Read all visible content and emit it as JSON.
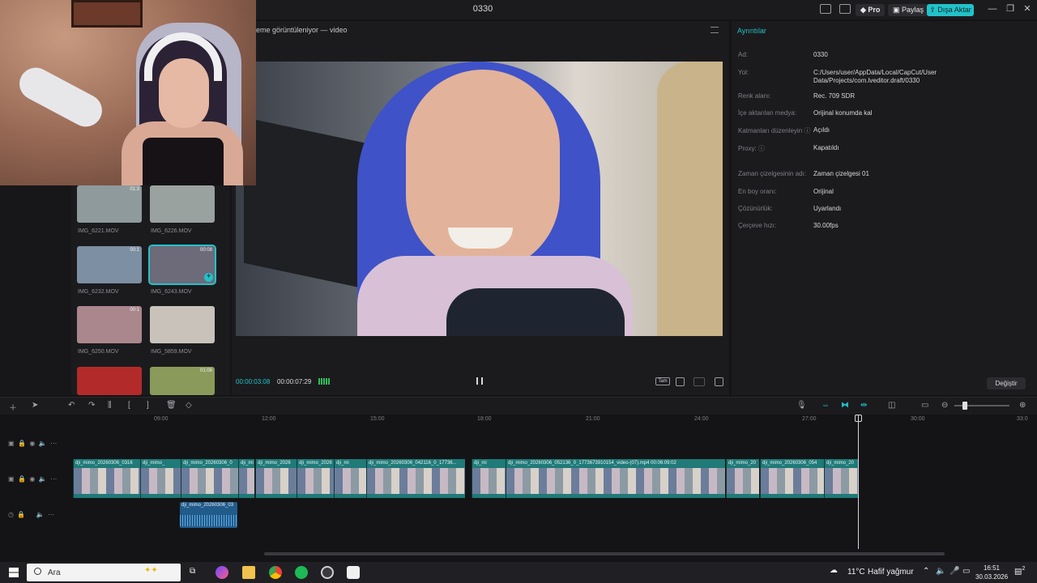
{
  "window": {
    "title": "0330"
  },
  "topbar": {
    "pro_label": "Pro",
    "share_label": "Paylaş",
    "export_label": "Dışa Aktar"
  },
  "player": {
    "title": "eme görüntüleniyor — video",
    "current_time": "00:00:03:08",
    "total_time": "00:00:07:29",
    "fit_label": "Tam"
  },
  "details": {
    "tab_label": "Ayrıntılar",
    "rows": [
      {
        "label": "Ad:",
        "value": "0330"
      },
      {
        "label": "Yol:",
        "value": "C:/Users/user/AppData/Local/CapCut/User Data/Projects/com.lveditor.draft/0330"
      },
      {
        "label": "Renk alanı:",
        "value": "Rec. 709 SDR"
      },
      {
        "label": "İçe aktarılan medya:",
        "value": "Orijinal konumda kal"
      },
      {
        "label": "Katmanları düzenleyin ⓘ",
        "value": "Açıldı"
      },
      {
        "label": "Proxy: ⓘ",
        "value": "Kapatıldı"
      },
      {
        "label": "Zaman çizelgesinin adı:",
        "value": "Zaman çizelgesi 01"
      },
      {
        "label": "En boy oranı:",
        "value": "Orijinal"
      },
      {
        "label": "Çözünürlük:",
        "value": "Uyarlandı"
      },
      {
        "label": "Çerçeve hızı:",
        "value": "30.00fps"
      }
    ],
    "change_label": "Değiştir"
  },
  "media": {
    "items": [
      {
        "name": "IMG_6221.MOV",
        "duration": "01:3",
        "color": "#8e9a9c"
      },
      {
        "name": "IMG_6226.MOV",
        "duration": "",
        "color": "#9aa2a0"
      },
      {
        "name": "IMG_6232.MOV",
        "duration": "00:1",
        "color": "#7d8fa3"
      },
      {
        "name": "IMG_6243.MOV",
        "duration": "00:08",
        "color": "#6d6a7a"
      },
      {
        "name": "IMG_6250.MOV",
        "duration": "00:1",
        "color": "#a9878c"
      },
      {
        "name": "IMG_5859.MOV",
        "duration": "",
        "color": "#c8c2ba"
      },
      {
        "name": "",
        "duration": "",
        "color": "#b32a2a"
      },
      {
        "name": "",
        "duration": "01:08",
        "color": "#8a9a5a"
      }
    ]
  },
  "timeline": {
    "ruler": [
      "09:00",
      "12:00",
      "15:00",
      "18:00",
      "21:00",
      "24:00",
      "27:00",
      "30:00",
      "33:0"
    ],
    "clips": [
      {
        "name": "dji_mimo_20260306_0316"
      },
      {
        "name": "dji_mimo_"
      },
      {
        "name": "dji_mimo_20260306_0"
      },
      {
        "name": "dji_mi"
      },
      {
        "name": "dji_mimo_2026"
      },
      {
        "name": "dji_mimo_2026"
      },
      {
        "name": "dji_mi"
      },
      {
        "name": "dji_mimo_20260306_042116_0_17736..."
      },
      {
        "name": "dji_mi"
      },
      {
        "name": "dji_mimo_20260306_052136_0_1773673910154_video-(07).mp4   00:06:09:02"
      },
      {
        "name": "dji_mimo_20"
      },
      {
        "name": "dji_mimo_20260306_054"
      },
      {
        "name": "dji_mimo_20"
      }
    ],
    "audio_clip": {
      "name": "dji_mimo_20260306_03"
    }
  },
  "taskbar": {
    "search_placeholder": "Ara",
    "weather": "11°C",
    "weather_desc": "Hafif yağmur",
    "time": "16:51",
    "date": "30.03.2026",
    "notifications": "2"
  },
  "colors": {
    "accent": "#22c2c9",
    "clip": "#1f7a78",
    "audio": "#215b8a"
  }
}
